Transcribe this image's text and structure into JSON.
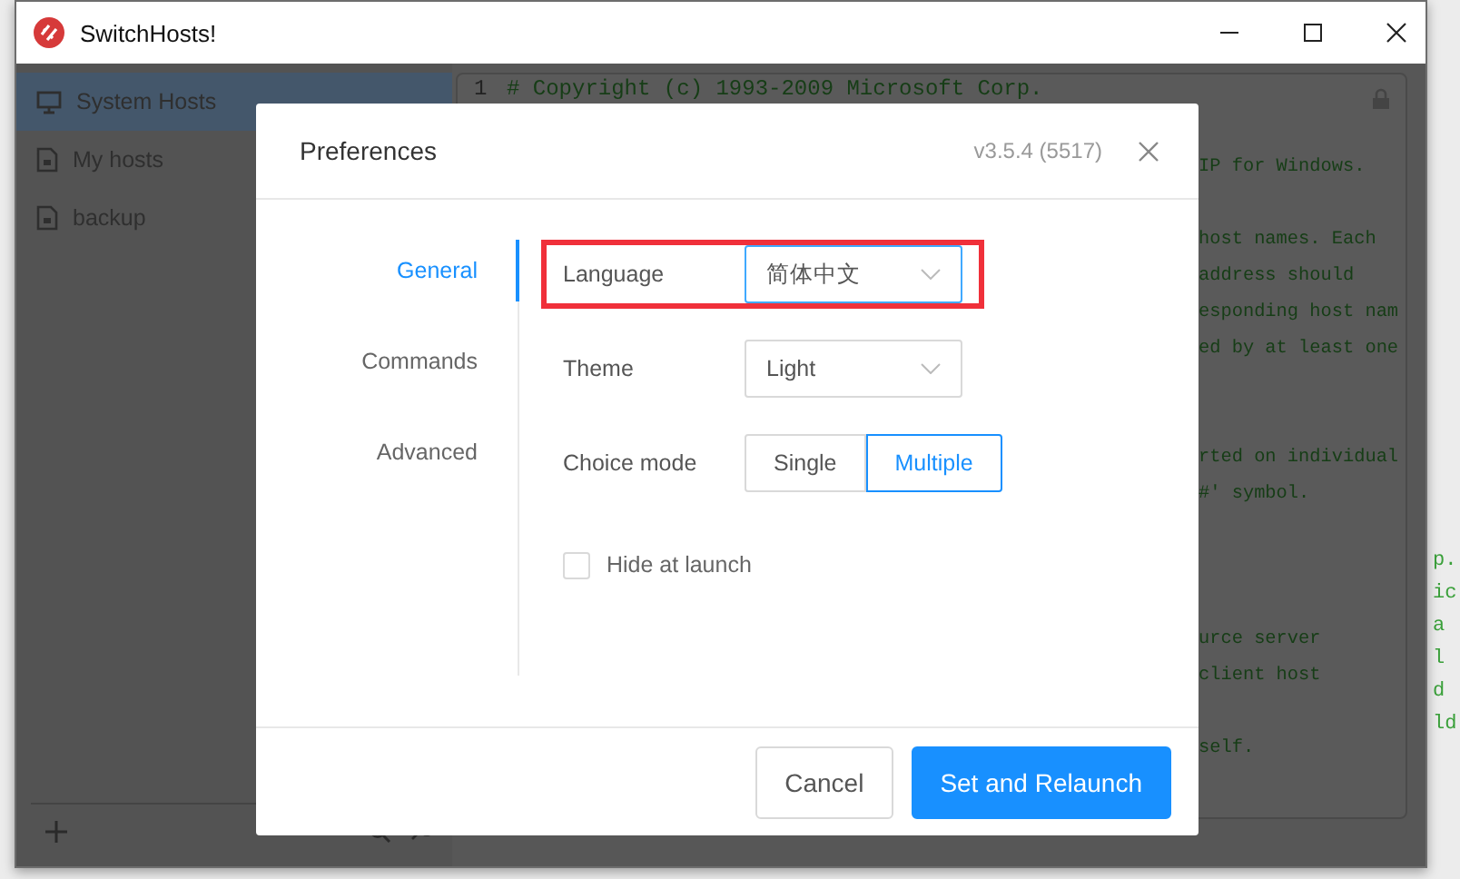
{
  "window": {
    "title": "SwitchHosts!"
  },
  "sidebar": {
    "items": [
      {
        "label": "System Hosts",
        "kind": "system",
        "selected": true
      },
      {
        "label": "My hosts",
        "kind": "file",
        "selected": false
      },
      {
        "label": "backup",
        "kind": "file",
        "selected": false
      }
    ]
  },
  "editor": {
    "line_number": "1",
    "first_line": "# Copyright (c) 1993-2009 Microsoft Corp.",
    "lines": [
      {
        "kind": "blank"
      },
      {
        "kind": "text",
        "text": "IP for Windows."
      },
      {
        "kind": "blank"
      },
      {
        "kind": "text",
        "text": "host names. Each"
      },
      {
        "kind": "text",
        "text": "address should"
      },
      {
        "kind": "text",
        "text": "esponding host nam"
      },
      {
        "kind": "text",
        "text": "ed by at least one"
      },
      {
        "kind": "blank"
      },
      {
        "kind": "blank"
      },
      {
        "kind": "text",
        "text": "rted on individual"
      },
      {
        "kind": "text",
        "text": "#' symbol."
      },
      {
        "kind": "blank"
      },
      {
        "kind": "blank"
      },
      {
        "kind": "blank"
      },
      {
        "kind": "text",
        "text": "urce server"
      },
      {
        "kind": "text",
        "text": "client host"
      },
      {
        "kind": "blank"
      },
      {
        "kind": "text",
        "text": "self."
      }
    ]
  },
  "desktop": {
    "right_fragments": [
      "p.",
      "ic",
      "a",
      "l",
      "d",
      "ld"
    ]
  },
  "dialog": {
    "title": "Preferences",
    "version": "v3.5.4 (5517)",
    "nav": [
      {
        "label": "General",
        "selected": true
      },
      {
        "label": "Commands",
        "selected": false
      },
      {
        "label": "Advanced",
        "selected": false
      }
    ],
    "settings": [
      {
        "kind": "select",
        "label": "Language",
        "value": "简体中文",
        "highlighted": true,
        "focused": true
      },
      {
        "kind": "select",
        "label": "Theme",
        "value": "Light",
        "highlighted": false,
        "focused": false
      },
      {
        "kind": "segmented",
        "label": "Choice mode",
        "options": [
          {
            "label": "Single",
            "selected": false
          },
          {
            "label": "Multiple",
            "selected": true
          }
        ]
      },
      {
        "kind": "checkbox",
        "label": "Hide at launch",
        "checked": false
      }
    ],
    "buttons": [
      {
        "label": "Cancel",
        "primary": false
      },
      {
        "label": "Set and Relaunch",
        "primary": true
      }
    ]
  }
}
